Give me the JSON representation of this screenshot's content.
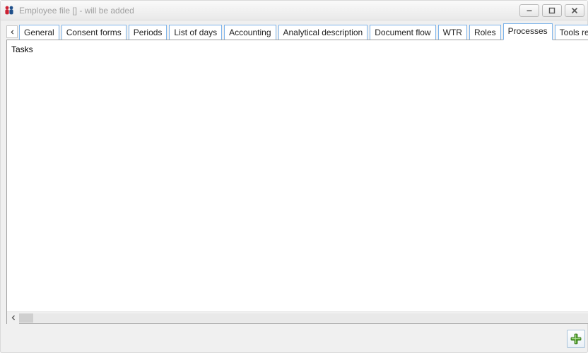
{
  "window": {
    "title": "Employee file [] - will be added"
  },
  "tabs": [
    {
      "label": "General",
      "active": false
    },
    {
      "label": "Consent forms",
      "active": false
    },
    {
      "label": "Periods",
      "active": false
    },
    {
      "label": "List of days",
      "active": false
    },
    {
      "label": "Accounting",
      "active": false
    },
    {
      "label": "Analytical description",
      "active": false
    },
    {
      "label": "Document flow",
      "active": false
    },
    {
      "label": "WTR",
      "active": false
    },
    {
      "label": "Roles",
      "active": false
    },
    {
      "label": "Processes",
      "active": true
    },
    {
      "label": "Tools released",
      "active": false
    }
  ],
  "content": {
    "header": "Tasks"
  },
  "icons": {
    "save": "save-icon",
    "close": "close-icon",
    "add": "plus-icon",
    "search": "magnifier-icon",
    "delete": "trash-icon",
    "lock": "lock-icon",
    "pin": "pin-icon"
  },
  "colors": {
    "tabBorder": "#7eb4ea",
    "accentGreen": "#55a531",
    "accentRed": "#cc2a1d",
    "accentBlue": "#2b5ea8"
  }
}
